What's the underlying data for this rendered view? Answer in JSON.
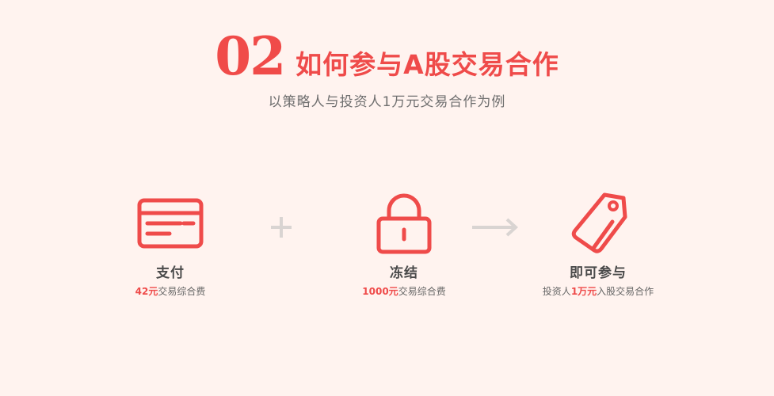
{
  "header": {
    "step_number": "02",
    "title": "如何参与A股交易合作",
    "subtitle": "以策略人与投资人1万元交易合作为例"
  },
  "steps": [
    {
      "icon": "credit-card-icon",
      "label": "支付",
      "desc_highlight": "42元",
      "desc_text": "交易综合费"
    },
    {
      "icon": "lock-icon",
      "label": "冻结",
      "desc_highlight": "1000元",
      "desc_text": "交易综合费"
    },
    {
      "icon": "price-tag-icon",
      "label": "即可参与",
      "desc_prefix": "投资人",
      "desc_highlight": "1万元",
      "desc_text": "入股交易合作"
    }
  ],
  "connectors": {
    "between_1_2": "plus-icon",
    "between_2_3": "arrow-right-icon"
  },
  "colors": {
    "accent": "#ef4b4a",
    "background": "#fff3ef",
    "connector": "#d9d4d2"
  }
}
